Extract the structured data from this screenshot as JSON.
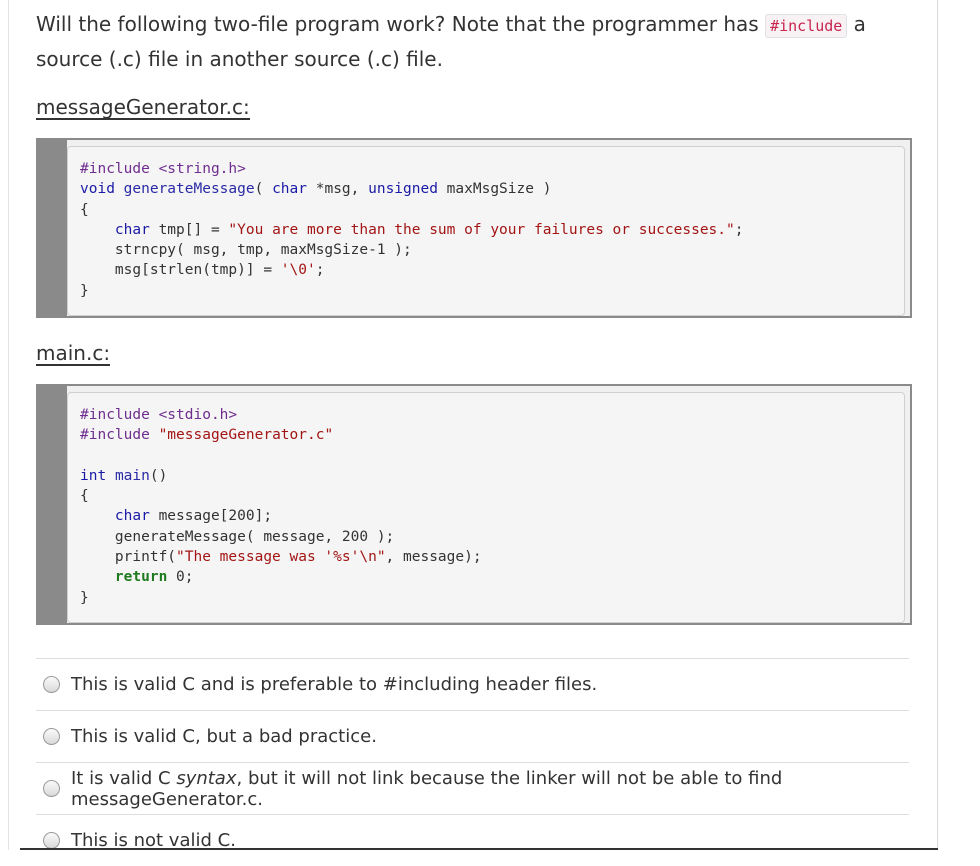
{
  "question": {
    "text_before": "Will the following two-file program work? Note that the programmer has ",
    "code": "#include",
    "text_after": " a source (.c) file in another source (.c) file."
  },
  "file1": {
    "label": "messageGenerator.c",
    "colon": ":"
  },
  "file2": {
    "label": "main.c",
    "colon": ":"
  },
  "code1": {
    "l1": "#include <string.h>",
    "l2_kw": "void",
    "l2_fn": "generateMessage",
    "l2_a": "( ",
    "l2_t1": "char",
    "l2_b": " *msg, ",
    "l2_t2": "unsigned",
    "l2_c": " maxMsgSize )",
    "l3": "{",
    "l4_t": "char",
    "l4_a": " tmp[] = ",
    "l4_s": "\"You are more than the sum of your failures or successes.\"",
    "l4_b": ";",
    "l5": "strncpy( msg, tmp, maxMsgSize-1 );",
    "l6_a": "msg[strlen(tmp)] = ",
    "l6_s": "'\\0'",
    "l6_b": ";",
    "l7": "}"
  },
  "code2": {
    "l1": "#include <stdio.h>",
    "l2_a": "#include ",
    "l2_s": "\"messageGenerator.c\"",
    "l3_t": "int",
    "l3_fn": "main",
    "l3_a": "()",
    "l4": "{",
    "l5_t": "char",
    "l5_a": " message[200];",
    "l6": "generateMessage( message, 200 );",
    "l7_a": "printf(",
    "l7_s": "\"The message was '%s'\\n\"",
    "l7_b": ", message);",
    "l8_r": "return",
    "l8_a": " 0;",
    "l9": "}"
  },
  "options": [
    {
      "label": "This is valid C and is preferable to #including header files."
    },
    {
      "label": "This is valid C, but a bad practice."
    },
    {
      "label_a": "It is valid C ",
      "label_em": "syntax",
      "label_b": ", but it will not link because the linker will not be able to find messageGenerator.c."
    },
    {
      "label": "This is not valid C."
    }
  ]
}
